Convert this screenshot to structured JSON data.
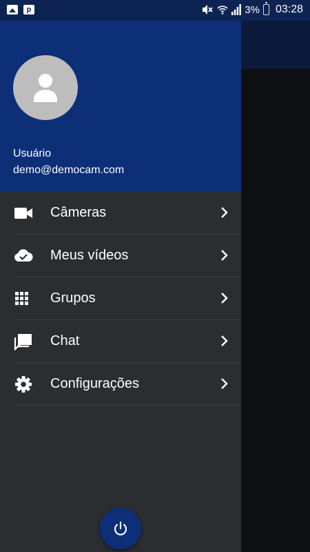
{
  "status_bar": {
    "battery": "3%",
    "time": "03:28",
    "icons": [
      "image-icon",
      "p-icon",
      "mute-icon",
      "wifi-icon",
      "signal-icon",
      "battery-icon"
    ]
  },
  "drawer": {
    "user_name": "Usuário",
    "user_email": "demo@democam.com",
    "header_color": "#0d2f78",
    "items": [
      {
        "label": "Câmeras",
        "icon": "videocam-icon"
      },
      {
        "label": "Meus vídeos",
        "icon": "cloud-done-icon"
      },
      {
        "label": "Grupos",
        "icon": "grid-icon"
      },
      {
        "label": "Chat",
        "icon": "chat-icon"
      },
      {
        "label": "Configurações",
        "icon": "gear-icon"
      }
    ],
    "power_icon": "power-icon"
  }
}
